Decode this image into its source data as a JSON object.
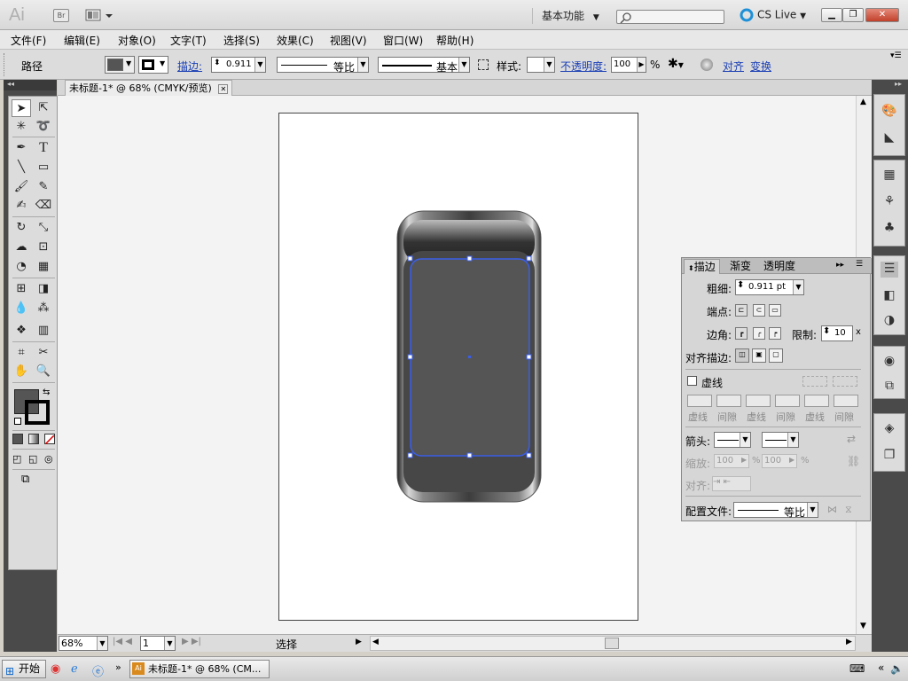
{
  "titlebar": {
    "app_logo": "Ai",
    "bridge_label": "Br",
    "workspace": "基本功能",
    "cs_live": "CS Live",
    "search_placeholder": ""
  },
  "menu": [
    "文件(F)",
    "编辑(E)",
    "对象(O)",
    "文字(T)",
    "选择(S)",
    "效果(C)",
    "视图(V)",
    "窗口(W)",
    "帮助(H)"
  ],
  "control_bar": {
    "selection_type": "路径",
    "stroke_label": "描边:",
    "stroke_weight": "0.911",
    "profile_label": "等比",
    "brush_label": "基本",
    "style_label": "样式:",
    "opacity_label": "不透明度:",
    "opacity_value": "100",
    "opacity_unit": "%",
    "align_label": "对齐",
    "transform_label": "变换"
  },
  "document": {
    "tab_title": "未标题-1* @ 68% (CMYK/预览)"
  },
  "status_bar": {
    "zoom": "68%",
    "page": "1",
    "tool_status": "选择"
  },
  "stroke_panel": {
    "tabs": [
      "描边",
      "渐变",
      "透明度"
    ],
    "weight_label": "粗细:",
    "weight_value": "0.911 pt",
    "cap_label": "端点:",
    "corner_label": "边角:",
    "limit_label": "限制:",
    "limit_value": "10",
    "limit_unit": "x",
    "align_label": "对齐描边:",
    "dashed_label": "虚线",
    "dash_labels": [
      "虚线",
      "间隙",
      "虚线",
      "间隙",
      "虚线",
      "间隙"
    ],
    "arrow_label": "箭头:",
    "scale_label": "缩放:",
    "scale_values": [
      "100",
      "100"
    ],
    "scale_unit": "%",
    "align_arrow_label": "对齐:",
    "profile_label": "配置文件:",
    "profile_value": "等比"
  },
  "taskbar": {
    "start": "开始",
    "active_task": "未标题-1* @ 68% (CM..."
  },
  "colors": {
    "fill": "#555555",
    "stroke": "#000000",
    "selection": "#3a5ee8"
  }
}
